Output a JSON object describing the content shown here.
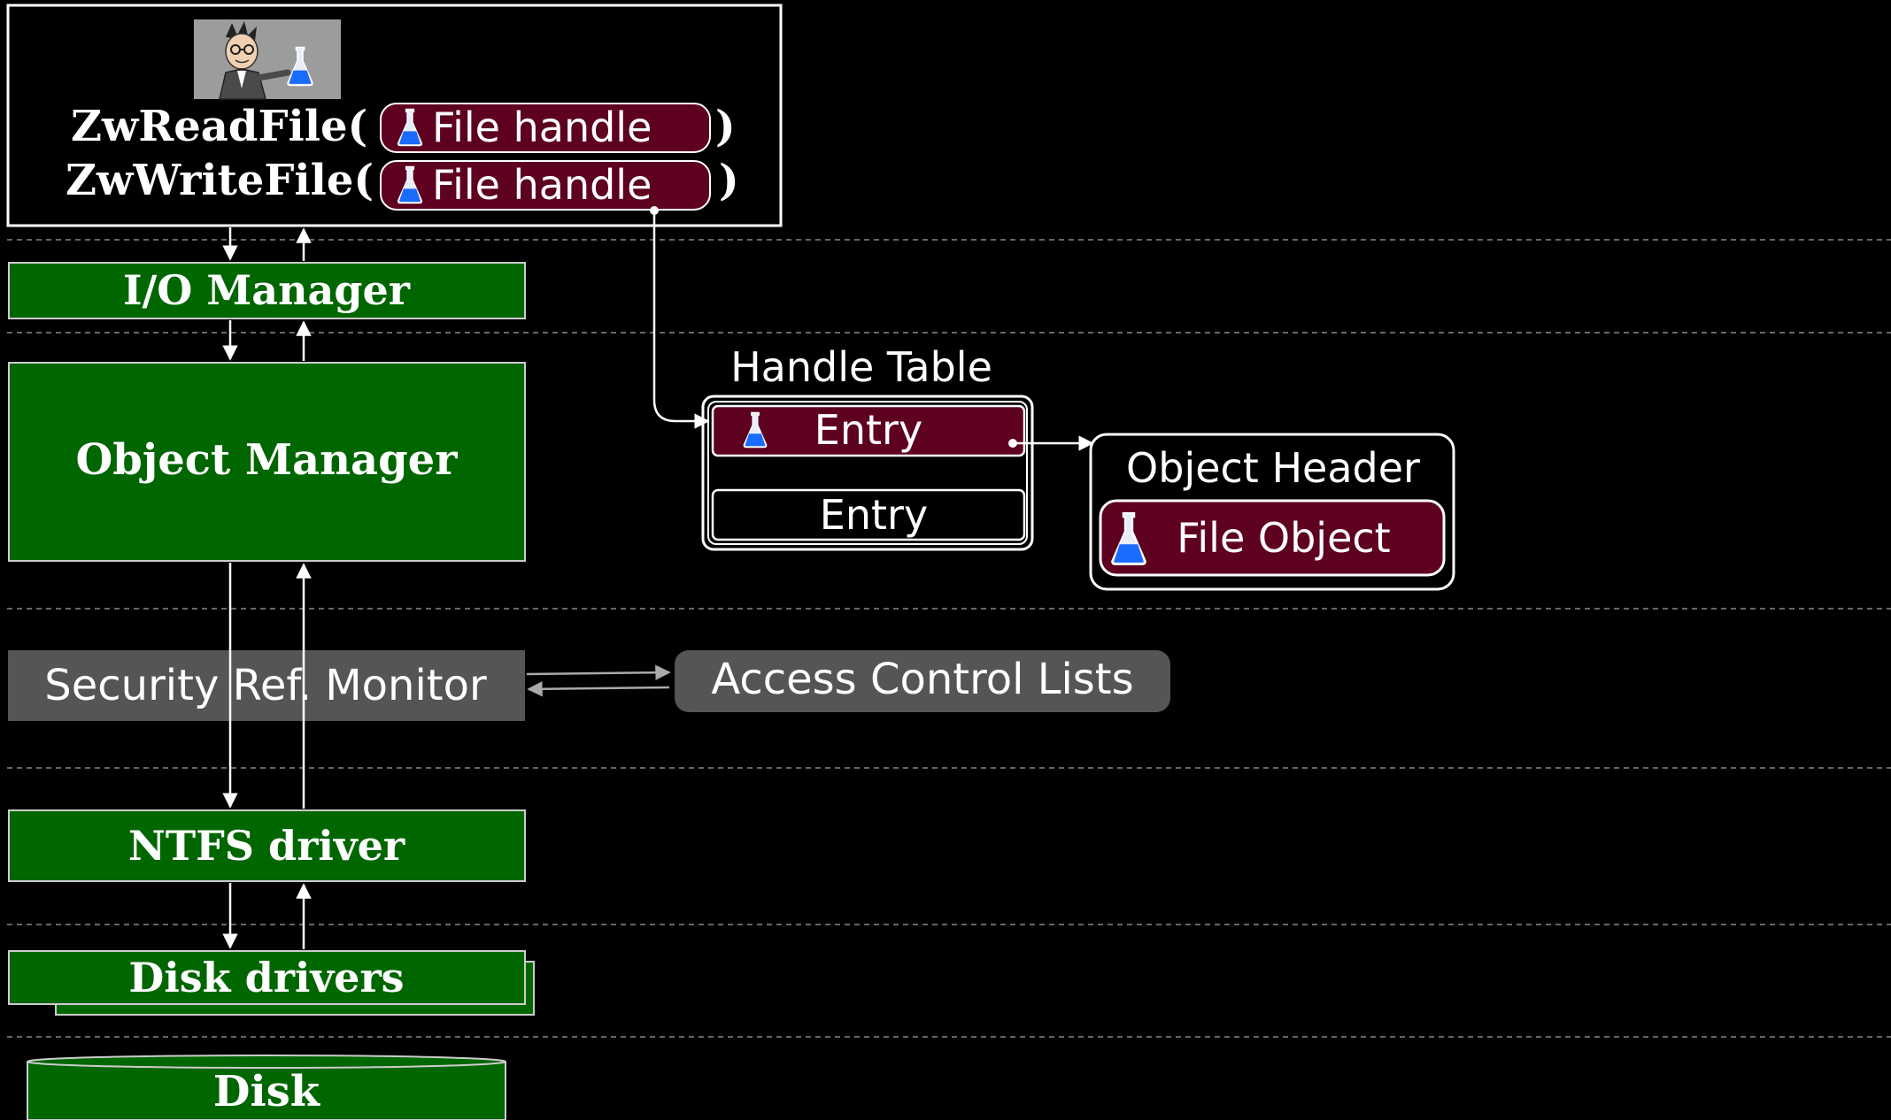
{
  "api": {
    "read_call": "ZwReadFile(",
    "write_call": "ZwWriteFile(",
    "handle_label": "File handle",
    "close_paren": ")"
  },
  "layers": {
    "io_manager": "I/O Manager",
    "object_manager": "Object Manager",
    "security_monitor": "Security Ref. Monitor",
    "ntfs_driver": "NTFS driver",
    "disk_drivers": "Disk drivers",
    "disk": "Disk"
  },
  "handle_table": {
    "title": "Handle Table",
    "entries": [
      "Entry",
      "Entry"
    ]
  },
  "object": {
    "header": "Object Header",
    "file_object": "File Object"
  },
  "acl": "Access Control Lists",
  "colors": {
    "green": "#006600",
    "maroon": "#5e0020",
    "gray": "#555555",
    "white": "#ffffff",
    "flask_blue": "#1a6cff"
  },
  "icons": [
    "cartoon-scientist-icon",
    "flask-icon"
  ]
}
